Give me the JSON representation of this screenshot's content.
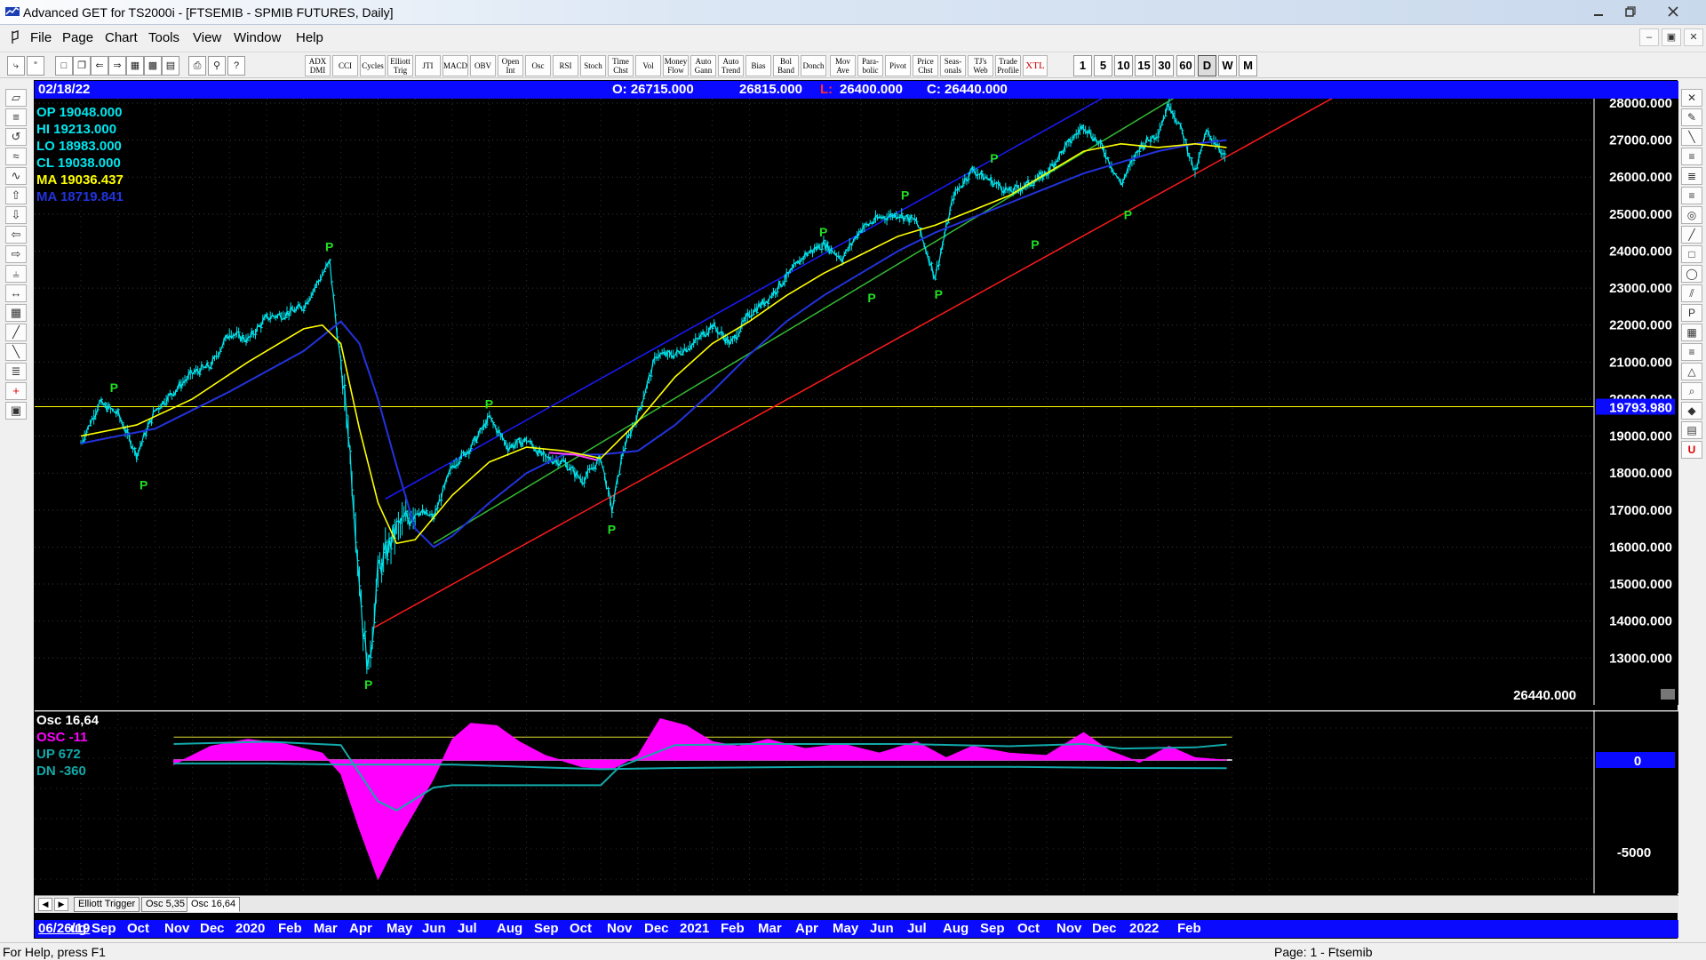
{
  "window": {
    "title": "Advanced GET for TS2000i - [FTSEMIB - SPMIB FUTURES, Daily]",
    "controls": [
      "minimize",
      "maximize",
      "close"
    ]
  },
  "menu": {
    "items": [
      "File",
      "Page",
      "Chart",
      "Tools",
      "View",
      "Window",
      "Help"
    ]
  },
  "toolbar": {
    "study_buttons": [
      "ADX DMI",
      "CCI",
      "Cycles",
      "Elliott Trig",
      "JTI",
      "MACD",
      "OBV",
      "Open Int",
      "Osc",
      "RSI",
      "Stoch",
      "Time Chst",
      "Vol",
      "Money Flow",
      "Auto Gann",
      "Auto Trend",
      "Bias",
      "Bol Band",
      "Donch",
      "Mov Ave",
      "Para-bolic",
      "Pivot",
      "Price Chst",
      "Seas-onals",
      "TJ's Web",
      "Trade Profile",
      "XTL"
    ],
    "timeframes": [
      "1",
      "5",
      "10",
      "15",
      "30",
      "60",
      "D",
      "W",
      "M"
    ],
    "active_timeframe": "D"
  },
  "info_bar": {
    "date": "02/18/22",
    "open": "O: 26715.000",
    "high": "26815.000",
    "low_label": "L:",
    "low_value": "26400.000",
    "close": "C: 26440.000"
  },
  "price_readout": {
    "op": "OP  19048.000",
    "hi": "HI   19213.000",
    "lo": "LO   18983.000",
    "cl": "CL   19038.000",
    "ma1": "MA  19036.437",
    "ma2": "MA  18719.841"
  },
  "colors": {
    "background": "#000000",
    "price_bars": "#00e5ee",
    "ma_fast": "#ffff00",
    "ma_slow": "#2233dd",
    "channel_upper": "#1a1aff",
    "channel_mid": "#33bb33",
    "trendline": "#ff1a1a",
    "pivot_label": "#22dd22",
    "osc_fill": "#ff00ff",
    "osc_band": "#11aaaa",
    "header_blue": "#0a0aff"
  },
  "price_axis": {
    "ticks": [
      "28000.000",
      "27000.000",
      "26000.000",
      "25000.000",
      "24000.000",
      "23000.000",
      "22000.000",
      "21000.000",
      "20000.000",
      "19000.000",
      "18000.000",
      "17000.000",
      "16000.000",
      "15000.000",
      "14000.000",
      "13000.000"
    ],
    "cursor_price": "19793.980",
    "last_price": "26440.000"
  },
  "oscillator": {
    "title": "Osc 16,64",
    "osc_label": "OSC -11",
    "up_label": "UP  672",
    "dn_label": "DN   -360",
    "axis_ticks": [
      "0",
      "-5000"
    ]
  },
  "osc_tabs": [
    "Elliott Trigger",
    "Osc 5,35",
    "Osc 16,64"
  ],
  "active_osc_tab": "Osc 16,64",
  "date_axis": {
    "start": "06/26/19",
    "months": [
      "ug",
      "Sep",
      "Oct",
      "Nov",
      "Dec",
      "2020",
      "Feb",
      "Mar",
      "Apr",
      "May",
      "Jun",
      "Jul",
      "Aug",
      "Sep",
      "Oct",
      "Nov",
      "Dec",
      "2021",
      "Feb",
      "Mar",
      "Apr",
      "May",
      "Jun",
      "Jul",
      "Aug",
      "Sep",
      "Oct",
      "Nov",
      "Dec",
      "2022",
      "Feb"
    ]
  },
  "status": {
    "left": "For Help, press F1",
    "right": "Page: 1 - Ftsemib"
  },
  "chart_data": {
    "type": "line",
    "ylim": [
      12300,
      28200
    ],
    "ticks": [
      28000,
      27000,
      26000,
      25000,
      24000,
      23000,
      22000,
      21000,
      20000,
      19000,
      18000,
      17000,
      16000,
      15000,
      14000,
      13000
    ],
    "cursor_line": 19793.98,
    "price_series": [
      {
        "m": 0,
        "v": 18800
      },
      {
        "m": 0.5,
        "v": 19900
      },
      {
        "m": 1.0,
        "v": 19600
      },
      {
        "m": 1.5,
        "v": 18500
      },
      {
        "m": 2.0,
        "v": 19700
      },
      {
        "m": 2.5,
        "v": 20200
      },
      {
        "m": 3.0,
        "v": 20700
      },
      {
        "m": 3.5,
        "v": 20900
      },
      {
        "m": 4.0,
        "v": 21800
      },
      {
        "m": 4.5,
        "v": 21600
      },
      {
        "m": 5.0,
        "v": 22200
      },
      {
        "m": 5.5,
        "v": 22300
      },
      {
        "m": 6.0,
        "v": 22500
      },
      {
        "m": 6.4,
        "v": 23200
      },
      {
        "m": 6.7,
        "v": 23700
      },
      {
        "m": 6.9,
        "v": 21800
      },
      {
        "m": 7.2,
        "v": 19200
      },
      {
        "m": 7.4,
        "v": 16500
      },
      {
        "m": 7.6,
        "v": 13800
      },
      {
        "m": 7.75,
        "v": 12700
      },
      {
        "m": 8.0,
        "v": 15300
      },
      {
        "m": 8.5,
        "v": 16500
      },
      {
        "m": 9.0,
        "v": 17000
      },
      {
        "m": 9.5,
        "v": 16800
      },
      {
        "m": 10.0,
        "v": 18200
      },
      {
        "m": 10.5,
        "v": 18700
      },
      {
        "m": 11.0,
        "v": 19500
      },
      {
        "m": 11.5,
        "v": 18700
      },
      {
        "m": 12.0,
        "v": 18900
      },
      {
        "m": 12.5,
        "v": 18400
      },
      {
        "m": 13.0,
        "v": 18300
      },
      {
        "m": 13.5,
        "v": 17800
      },
      {
        "m": 14.0,
        "v": 18400
      },
      {
        "m": 14.3,
        "v": 17000
      },
      {
        "m": 14.6,
        "v": 18600
      },
      {
        "m": 15.0,
        "v": 19600
      },
      {
        "m": 15.5,
        "v": 21200
      },
      {
        "m": 16.0,
        "v": 21200
      },
      {
        "m": 16.5,
        "v": 21500
      },
      {
        "m": 17.0,
        "v": 22000
      },
      {
        "m": 17.5,
        "v": 21500
      },
      {
        "m": 18.0,
        "v": 22300
      },
      {
        "m": 18.5,
        "v": 22700
      },
      {
        "m": 19.0,
        "v": 23300
      },
      {
        "m": 19.5,
        "v": 23900
      },
      {
        "m": 20.0,
        "v": 24200
      },
      {
        "m": 20.5,
        "v": 23800
      },
      {
        "m": 21.0,
        "v": 24600
      },
      {
        "m": 21.5,
        "v": 24900
      },
      {
        "m": 22.0,
        "v": 25000
      },
      {
        "m": 22.5,
        "v": 24800
      },
      {
        "m": 23.0,
        "v": 23300
      },
      {
        "m": 23.5,
        "v": 25500
      },
      {
        "m": 24.0,
        "v": 26200
      },
      {
        "m": 24.5,
        "v": 25900
      },
      {
        "m": 25.0,
        "v": 25600
      },
      {
        "m": 25.5,
        "v": 25800
      },
      {
        "m": 26.0,
        "v": 26100
      },
      {
        "m": 26.5,
        "v": 26800
      },
      {
        "m": 27.0,
        "v": 27400
      },
      {
        "m": 27.5,
        "v": 26800
      },
      {
        "m": 28.0,
        "v": 25800
      },
      {
        "m": 28.5,
        "v": 26800
      },
      {
        "m": 29.0,
        "v": 27200
      },
      {
        "m": 29.3,
        "v": 28000
      },
      {
        "m": 29.7,
        "v": 27100
      },
      {
        "m": 30.0,
        "v": 26100
      },
      {
        "m": 30.3,
        "v": 27200
      },
      {
        "m": 30.6,
        "v": 26900
      },
      {
        "m": 30.85,
        "v": 26440
      }
    ],
    "ma_fast": [
      {
        "m": 0,
        "v": 19000
      },
      {
        "m": 1.5,
        "v": 19300
      },
      {
        "m": 3,
        "v": 20000
      },
      {
        "m": 4.5,
        "v": 21000
      },
      {
        "m": 6,
        "v": 21900
      },
      {
        "m": 6.5,
        "v": 22000
      },
      {
        "m": 7,
        "v": 21500
      },
      {
        "m": 7.5,
        "v": 19200
      },
      {
        "m": 8,
        "v": 17200
      },
      {
        "m": 8.5,
        "v": 16100
      },
      {
        "m": 9,
        "v": 16200
      },
      {
        "m": 10,
        "v": 17400
      },
      {
        "m": 11,
        "v": 18300
      },
      {
        "m": 12,
        "v": 18700
      },
      {
        "m": 13,
        "v": 18600
      },
      {
        "m": 14,
        "v": 18400
      },
      {
        "m": 15,
        "v": 19400
      },
      {
        "m": 16,
        "v": 20600
      },
      {
        "m": 17,
        "v": 21500
      },
      {
        "m": 18,
        "v": 22100
      },
      {
        "m": 19,
        "v": 22800
      },
      {
        "m": 20,
        "v": 23400
      },
      {
        "m": 21,
        "v": 23900
      },
      {
        "m": 22,
        "v": 24400
      },
      {
        "m": 23,
        "v": 24700
      },
      {
        "m": 24,
        "v": 25100
      },
      {
        "m": 25,
        "v": 25500
      },
      {
        "m": 26,
        "v": 26100
      },
      {
        "m": 27,
        "v": 26700
      },
      {
        "m": 28,
        "v": 26900
      },
      {
        "m": 29,
        "v": 26800
      },
      {
        "m": 30,
        "v": 26900
      },
      {
        "m": 30.85,
        "v": 26800
      }
    ],
    "ma_slow": [
      {
        "m": 0,
        "v": 18800
      },
      {
        "m": 2,
        "v": 19200
      },
      {
        "m": 4,
        "v": 20200
      },
      {
        "m": 6,
        "v": 21300
      },
      {
        "m": 7,
        "v": 22100
      },
      {
        "m": 7.5,
        "v": 21500
      },
      {
        "m": 8,
        "v": 20000
      },
      {
        "m": 8.5,
        "v": 18200
      },
      {
        "m": 9,
        "v": 16500
      },
      {
        "m": 9.5,
        "v": 16000
      },
      {
        "m": 10,
        "v": 16300
      },
      {
        "m": 11,
        "v": 17200
      },
      {
        "m": 12,
        "v": 18000
      },
      {
        "m": 13,
        "v": 18500
      },
      {
        "m": 14,
        "v": 18500
      },
      {
        "m": 15,
        "v": 18600
      },
      {
        "m": 16,
        "v": 19300
      },
      {
        "m": 17,
        "v": 20200
      },
      {
        "m": 18,
        "v": 21200
      },
      {
        "m": 19,
        "v": 22100
      },
      {
        "m": 20,
        "v": 22800
      },
      {
        "m": 21,
        "v": 23400
      },
      {
        "m": 22,
        "v": 24000
      },
      {
        "m": 23,
        "v": 24500
      },
      {
        "m": 24,
        "v": 24900
      },
      {
        "m": 25,
        "v": 25300
      },
      {
        "m": 26,
        "v": 25700
      },
      {
        "m": 27,
        "v": 26100
      },
      {
        "m": 28,
        "v": 26400
      },
      {
        "m": 29,
        "v": 26700
      },
      {
        "m": 30,
        "v": 26900
      },
      {
        "m": 30.85,
        "v": 27000
      }
    ],
    "trendlines": [
      {
        "name": "channel_upper",
        "from": {
          "m": 8.2,
          "v": 17300
        },
        "to": {
          "m": 27.8,
          "v": 28300
        }
      },
      {
        "name": "channel_mid",
        "from": {
          "m": 9.5,
          "v": 16100
        },
        "to": {
          "m": 29.7,
          "v": 28300
        }
      },
      {
        "name": "trendline",
        "from": {
          "m": 7.85,
          "v": 13800
        },
        "to": {
          "m": 34.0,
          "v": 28300
        }
      }
    ],
    "pivots": [
      {
        "m": 0.9,
        "v": 20100,
        "pos": "above"
      },
      {
        "m": 1.7,
        "v": 17900,
        "pos": "below"
      },
      {
        "m": 6.7,
        "v": 23900,
        "pos": "above"
      },
      {
        "m": 7.75,
        "v": 12500,
        "pos": "below"
      },
      {
        "m": 11.0,
        "v": 19650,
        "pos": "above"
      },
      {
        "m": 14.3,
        "v": 16700,
        "pos": "below"
      },
      {
        "m": 20.0,
        "v": 24300,
        "pos": "above"
      },
      {
        "m": 21.3,
        "v": 22950,
        "pos": "below"
      },
      {
        "m": 22.2,
        "v": 25300,
        "pos": "above"
      },
      {
        "m": 23.1,
        "v": 23050,
        "pos": "below"
      },
      {
        "m": 24.6,
        "v": 26300,
        "pos": "above"
      },
      {
        "m": 25.7,
        "v": 24400,
        "pos": "below"
      },
      {
        "m": 27.2,
        "v": 28100,
        "pos": "above"
      },
      {
        "m": 28.2,
        "v": 25200,
        "pos": "below"
      }
    ],
    "oscillator": {
      "ylim": [
        -5500,
        2400
      ],
      "zero": 0,
      "values": [
        {
          "m": 2.5,
          "v": -200
        },
        {
          "m": 3.5,
          "v": 600
        },
        {
          "m": 4.5,
          "v": 900
        },
        {
          "m": 5.5,
          "v": 700
        },
        {
          "m": 6.5,
          "v": 300
        },
        {
          "m": 7.0,
          "v": -600
        },
        {
          "m": 7.5,
          "v": -3000
        },
        {
          "m": 8.0,
          "v": -5200
        },
        {
          "m": 8.5,
          "v": -3600
        },
        {
          "m": 9.0,
          "v": -2200
        },
        {
          "m": 9.5,
          "v": -800
        },
        {
          "m": 10.0,
          "v": 900
        },
        {
          "m": 10.5,
          "v": 1600
        },
        {
          "m": 11.2,
          "v": 1500
        },
        {
          "m": 11.8,
          "v": 800
        },
        {
          "m": 12.5,
          "v": 200
        },
        {
          "m": 13.5,
          "v": -300
        },
        {
          "m": 14.3,
          "v": -400
        },
        {
          "m": 15.0,
          "v": 200
        },
        {
          "m": 15.6,
          "v": 1800
        },
        {
          "m": 16.3,
          "v": 1500
        },
        {
          "m": 17.0,
          "v": 800
        },
        {
          "m": 17.7,
          "v": 600
        },
        {
          "m": 18.5,
          "v": 900
        },
        {
          "m": 19.5,
          "v": 500
        },
        {
          "m": 20.5,
          "v": 700
        },
        {
          "m": 21.5,
          "v": 300
        },
        {
          "m": 22.5,
          "v": 800
        },
        {
          "m": 23.3,
          "v": 100
        },
        {
          "m": 24.0,
          "v": 600
        },
        {
          "m": 25.0,
          "v": 300
        },
        {
          "m": 26.0,
          "v": 200
        },
        {
          "m": 27.0,
          "v": 1200
        },
        {
          "m": 27.7,
          "v": 400
        },
        {
          "m": 28.5,
          "v": -100
        },
        {
          "m": 29.3,
          "v": 600
        },
        {
          "m": 30.0,
          "v": 100
        },
        {
          "m": 30.85,
          "v": -11
        }
      ],
      "up_band": [
        {
          "m": 2.5,
          "v": 700
        },
        {
          "m": 5,
          "v": 800
        },
        {
          "m": 7,
          "v": 650
        },
        {
          "m": 8,
          "v": -1800
        },
        {
          "m": 8.5,
          "v": -2200
        },
        {
          "m": 9.5,
          "v": -1200
        },
        {
          "m": 10,
          "v": -1100
        },
        {
          "m": 14,
          "v": -1100
        },
        {
          "m": 14.5,
          "v": -300
        },
        {
          "m": 16,
          "v": 650
        },
        {
          "m": 18,
          "v": 700
        },
        {
          "m": 22,
          "v": 700
        },
        {
          "m": 25,
          "v": 600
        },
        {
          "m": 27,
          "v": 700
        },
        {
          "m": 28,
          "v": 500
        },
        {
          "m": 30,
          "v": 550
        },
        {
          "m": 30.85,
          "v": 672
        }
      ],
      "dn_band": [
        {
          "m": 2.5,
          "v": -150
        },
        {
          "m": 5,
          "v": -150
        },
        {
          "m": 7,
          "v": -200
        },
        {
          "m": 10,
          "v": -200
        },
        {
          "m": 14,
          "v": -400
        },
        {
          "m": 16,
          "v": -350
        },
        {
          "m": 20,
          "v": -300
        },
        {
          "m": 25,
          "v": -300
        },
        {
          "m": 28,
          "v": -350
        },
        {
          "m": 30.85,
          "v": -360
        }
      ]
    }
  }
}
